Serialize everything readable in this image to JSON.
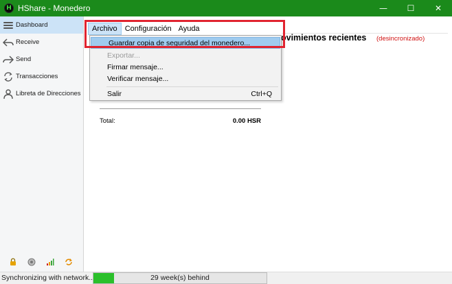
{
  "window": {
    "title": "HShare - Monedero",
    "icon_letter": "H",
    "minimize_glyph": "—",
    "maximize_glyph": "☐",
    "close_glyph": "✕"
  },
  "sidebar": {
    "items": [
      {
        "label": "Dashboard",
        "icon": "dashboard-icon"
      },
      {
        "label": "Receive",
        "icon": "receive-icon"
      },
      {
        "label": "Send",
        "icon": "send-icon"
      },
      {
        "label": "Transacciones",
        "icon": "transactions-icon"
      },
      {
        "label": "Libreta de Direcciones",
        "icon": "address-book-icon"
      }
    ],
    "status_icons": [
      "lock-icon",
      "staking-icon",
      "signal-icon",
      "sync-icon"
    ]
  },
  "menubar": {
    "items": [
      "Archivo",
      "Configuración",
      "Ayuda"
    ],
    "open_menu": "Archivo"
  },
  "file_menu": {
    "backup": "Guardar copia de seguridad del monedero...",
    "export": "Exportar...",
    "sign": "Firmar mensaje...",
    "verify": "Verificar mensaje...",
    "exit": "Salir",
    "exit_shortcut": "Ctrl+Q"
  },
  "dashboard": {
    "recent_title": "ovimientos recientes",
    "recent_status": "(desincronizado)",
    "total_label": "Total:",
    "total_value": "0.00 HSR"
  },
  "statusbar": {
    "sync_text": "Synchronizing with network...",
    "progress_label": "29 week(s) behind",
    "progress_fraction": 0.12
  },
  "colors": {
    "titlebar": "#1b8a1b",
    "sidebar_active": "#cce3f7",
    "menu_highlight": "#9fcbef",
    "callout_border": "#e1232f",
    "progress_fill": "#2bc02b",
    "warning_text": "#d01010"
  }
}
